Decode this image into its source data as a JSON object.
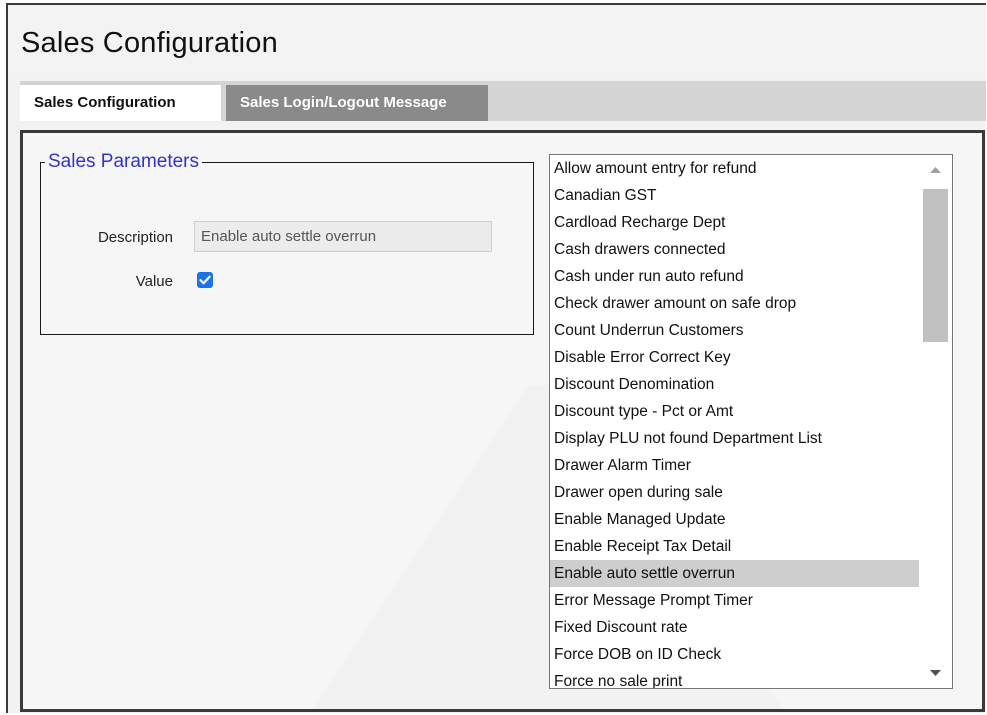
{
  "page": {
    "title": "Sales Configuration"
  },
  "tabs": [
    {
      "label": "Sales Configuration",
      "active": true
    },
    {
      "label": "Sales Login/Logout Message",
      "active": false
    }
  ],
  "params": {
    "legend": "Sales Parameters",
    "description_label": "Description",
    "description_value": "Enable auto settle overrun",
    "value_label": "Value",
    "value_checked": true
  },
  "list": {
    "items": [
      "Allow amount entry for refund",
      "Canadian GST",
      "Cardload Recharge Dept",
      "Cash drawers connected",
      "Cash under run auto refund",
      "Check drawer amount on safe drop",
      "Count Underrun Customers",
      "Disable Error Correct Key",
      "Discount Denomination",
      "Discount type - Pct or Amt",
      "Display PLU not found Department List",
      "Drawer Alarm Timer",
      "Drawer open during sale",
      "Enable Managed Update",
      "Enable Receipt Tax Detail",
      "Enable auto settle overrun",
      "Error Message Prompt Timer",
      "Fixed Discount rate",
      "Force DOB on ID Check",
      "Force no sale print"
    ],
    "selected": "Enable auto settle overrun"
  },
  "colors": {
    "legend": "#3333cc",
    "checkbox": "#1a73e8",
    "selected_row": "#cecece",
    "inactive_tab": "#8a8a8a"
  }
}
